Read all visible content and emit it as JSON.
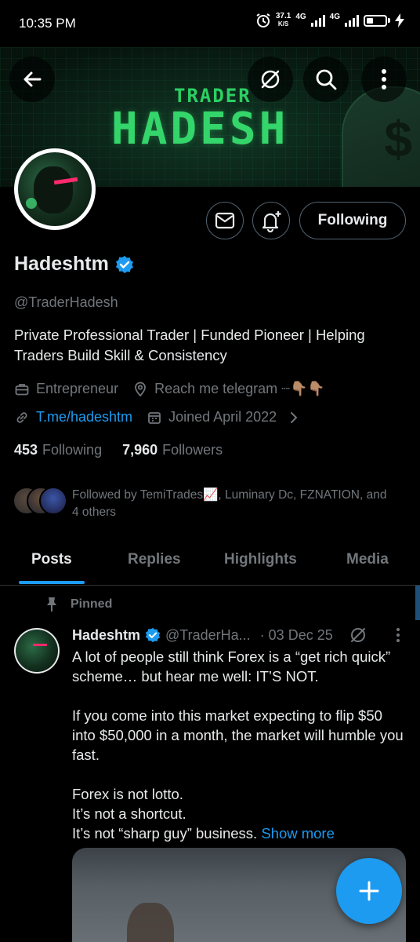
{
  "status_bar": {
    "time": "10:35 PM",
    "net_speed_value": "37.1",
    "net_speed_unit": "K/S",
    "network_1": "4G",
    "network_2": "4G",
    "battery_icon": "battery-icon"
  },
  "banner": {
    "subtitle": "TRADER",
    "title": "HADESH"
  },
  "header": {
    "back_icon": "arrow-left-icon",
    "grok_icon": "grok-icon",
    "search_icon": "search-icon",
    "more_icon": "more-vertical-icon"
  },
  "actions": {
    "message_icon": "envelope-icon",
    "notify_icon": "bell-plus-icon",
    "follow_label": "Following"
  },
  "profile": {
    "name": "Hadeshtm",
    "verified_color": "#1d9bf0",
    "handle": "@TraderHadesh",
    "bio_line1": "Private Professional Trader | Funded Pioneer | Helping",
    "bio_line2": "Traders Build Skill & Consistency",
    "category": "Entrepreneur",
    "location": "Reach me telegram ┈👇🏽👇🏽",
    "website": "T.me/hadeshtm",
    "joined": "Joined April 2022",
    "following_count": "453",
    "following_label": "Following",
    "followers_count": "7,960",
    "followers_label": "Followers",
    "followed_by_line1": "Followed by TemiTrades📈, Luminary Dc, FZNATION, and",
    "followed_by_line2": "4 others"
  },
  "tabs": [
    {
      "label": "Posts",
      "active": true
    },
    {
      "label": "Replies",
      "active": false
    },
    {
      "label": "Highlights",
      "active": false
    },
    {
      "label": "Media",
      "active": false
    }
  ],
  "post": {
    "pinned_label": "Pinned",
    "author": "Hadeshtm",
    "handle": "@TraderHa...",
    "date": "· 03 Dec 25",
    "text_p1": "A lot of people still think Forex is a “get rich quick” scheme… but hear me well: IT’S NOT.",
    "text_p2": "If you come into this market expecting to flip $50 into $50,000 in a month, the market will humble you fast.",
    "text_l1": "Forex is not lotto.",
    "text_l2": "It’s not a shortcut.",
    "text_l3": "It’s not “sharp guy” business.",
    "show_more": "Show more"
  },
  "fab": {
    "icon": "plus-icon",
    "color": "#1d9bf0"
  }
}
